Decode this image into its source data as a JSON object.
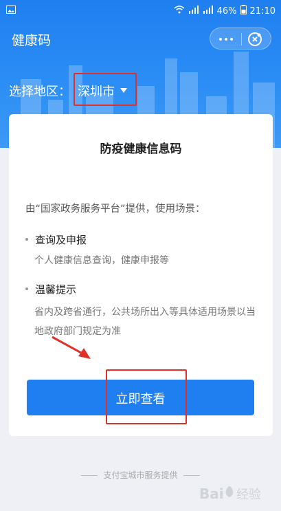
{
  "status_bar": {
    "battery": "46%",
    "time": "21:10",
    "signal_1": "4G",
    "signal_2": "4G"
  },
  "header": {
    "title": "健康码"
  },
  "region": {
    "label": "选择地区：",
    "value": "深圳市"
  },
  "card": {
    "title": "防疫健康信息码",
    "intro": "由“国家政务服务平台”提供，使用场景：",
    "sections": [
      {
        "heading": "查询及申报",
        "body": "个人健康信息查询，健康申报等"
      },
      {
        "heading": "温馨提示",
        "body": "省内及跨省通行，公共场所出入等具体适用场景以当地政府部门规定为准"
      }
    ],
    "button_label": "立即查看"
  },
  "footer": {
    "text": "支付宝城市服务提供"
  },
  "watermark": {
    "text": "Bai 经验"
  },
  "colors": {
    "primary": "#1f7ff0",
    "highlight": "#e0302a"
  }
}
